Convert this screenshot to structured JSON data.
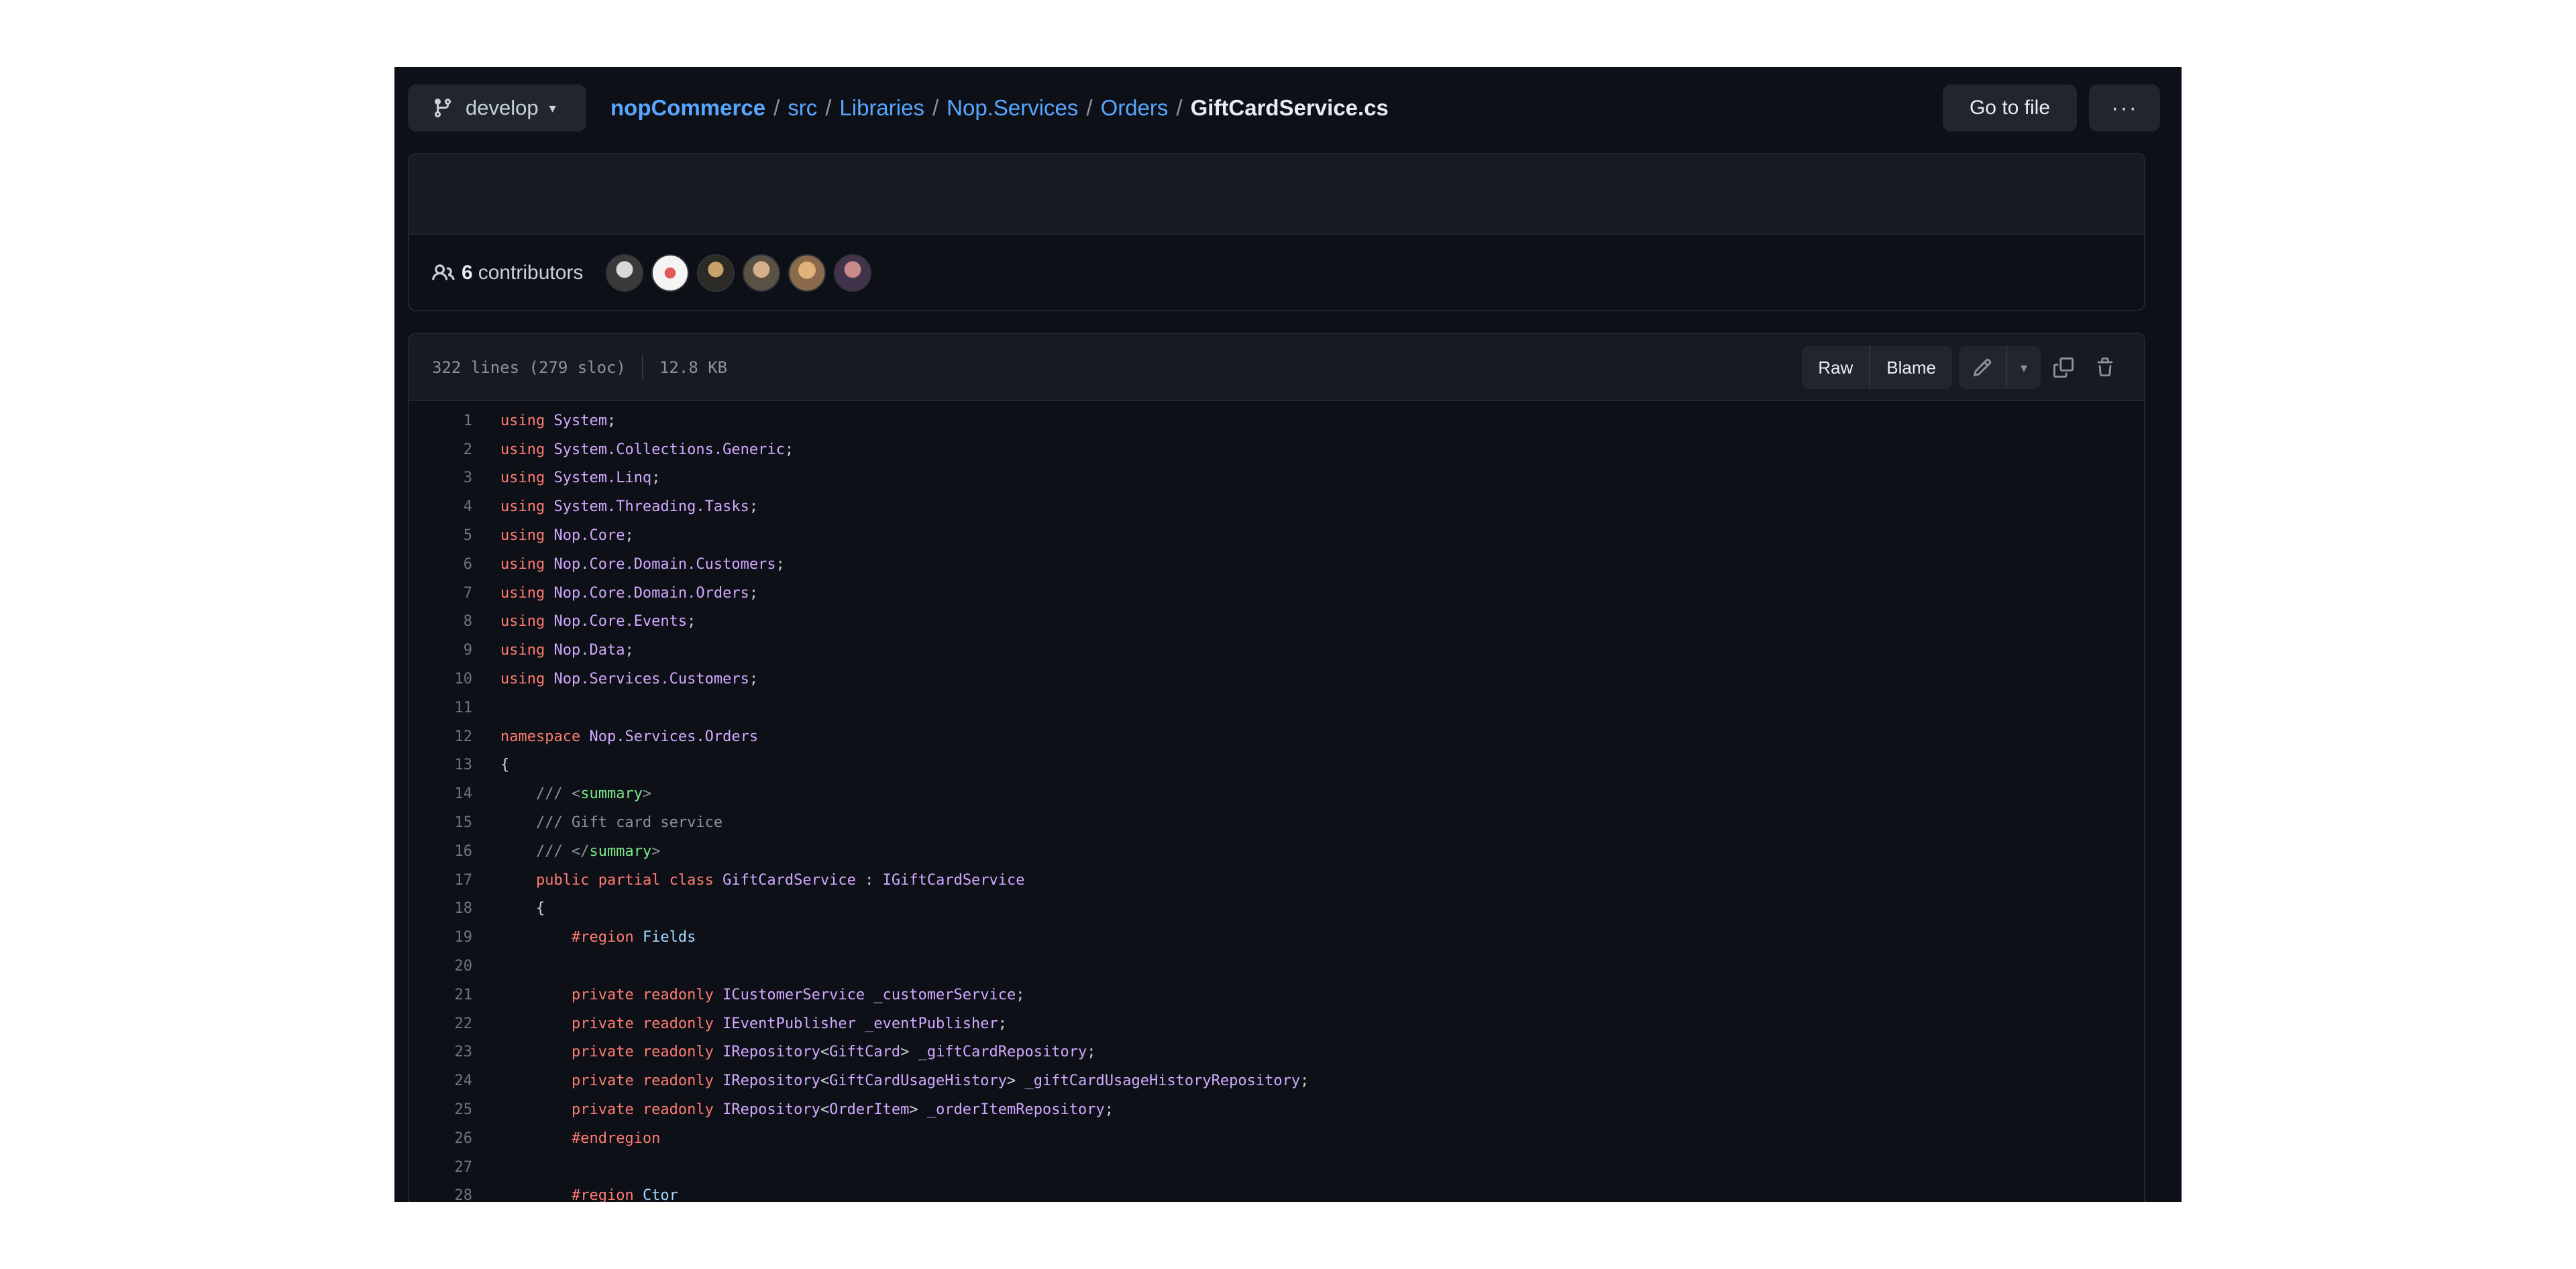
{
  "branch": {
    "name": "develop"
  },
  "breadcrumb": {
    "repo": "nopCommerce",
    "parts": [
      "src",
      "Libraries",
      "Nop.Services",
      "Orders"
    ],
    "file": "GiftCardService.cs",
    "separator": "/"
  },
  "toolbar": {
    "goto_label": "Go to file",
    "more_label": "···"
  },
  "contributors": {
    "count": "6",
    "label": "contributors"
  },
  "file": {
    "lines_info": "322 lines (279 sloc)",
    "size": "12.8 KB",
    "raw_label": "Raw",
    "blame_label": "Blame"
  },
  "code": {
    "lines": [
      "using System;",
      "using System.Collections.Generic;",
      "using System.Linq;",
      "using System.Threading.Tasks;",
      "using Nop.Core;",
      "using Nop.Core.Domain.Customers;",
      "using Nop.Core.Domain.Orders;",
      "using Nop.Core.Events;",
      "using Nop.Data;",
      "using Nop.Services.Customers;",
      "",
      "namespace Nop.Services.Orders",
      "{",
      "    /// <summary>",
      "    /// Gift card service",
      "    /// </summary>",
      "    public partial class GiftCardService : IGiftCardService",
      "    {",
      "        #region Fields",
      "",
      "        private readonly ICustomerService _customerService;",
      "        private readonly IEventPublisher _eventPublisher;",
      "        private readonly IRepository<GiftCard> _giftCardRepository;",
      "        private readonly IRepository<GiftCardUsageHistory> _giftCardUsageHistoryRepository;",
      "        private readonly IRepository<OrderItem> _orderItemRepository;",
      "        #endregion",
      "",
      "        #region Ctor"
    ]
  },
  "colors": {
    "background": "#0d1117",
    "keyword": "#ff7b72",
    "namespace": "#d2a8ff",
    "xml_tag": "#7ee787",
    "comment": "#8b949e",
    "link": "#58a6ff"
  }
}
